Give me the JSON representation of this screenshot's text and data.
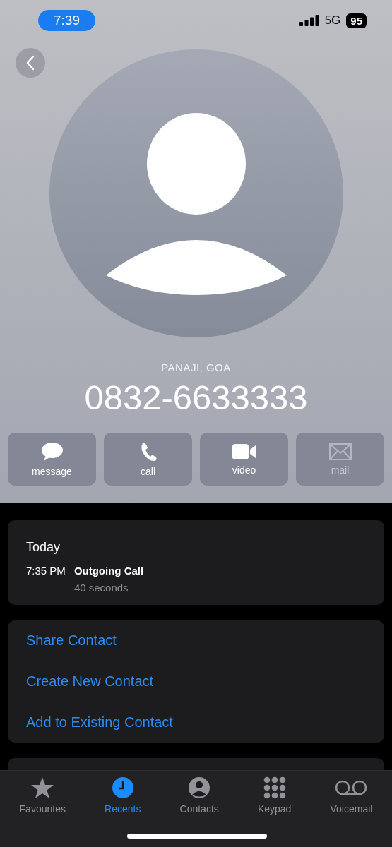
{
  "status_bar": {
    "time": "7:39",
    "network": "5G",
    "battery": "95"
  },
  "contact": {
    "location": "PANAJI, GOA",
    "number": "0832-6633333"
  },
  "actions": [
    {
      "kind": "message",
      "label": "message",
      "disabled": false
    },
    {
      "kind": "call",
      "label": "call",
      "disabled": false
    },
    {
      "kind": "video",
      "label": "video",
      "disabled": false
    },
    {
      "kind": "mail",
      "label": "mail",
      "disabled": true
    }
  ],
  "call_log": {
    "date": "Today",
    "entries": [
      {
        "time": "7:35 PM",
        "type": "Outgoing Call",
        "duration": "40 seconds"
      }
    ]
  },
  "options": [
    "Share Contact",
    "Create New Contact",
    "Add to Existing Contact"
  ],
  "tabs": [
    {
      "kind": "favourites",
      "label": "Favourites",
      "selected": false
    },
    {
      "kind": "recents",
      "label": "Recents",
      "selected": true
    },
    {
      "kind": "contacts",
      "label": "Contacts",
      "selected": false
    },
    {
      "kind": "keypad",
      "label": "Keypad",
      "selected": false
    },
    {
      "kind": "voicemail",
      "label": "Voicemail",
      "selected": false
    }
  ]
}
